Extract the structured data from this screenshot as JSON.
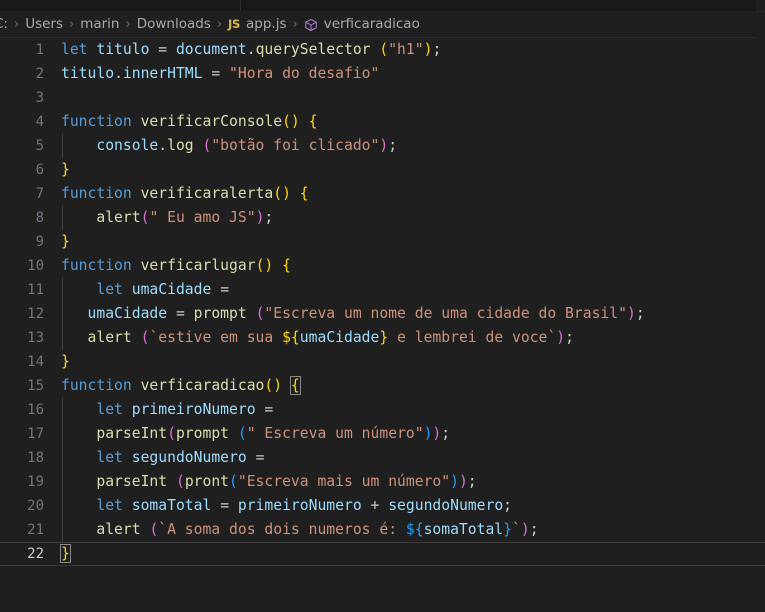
{
  "window": {
    "background": "#1f1f1f",
    "tabstrip_background": "#181818"
  },
  "breadcrumb": {
    "name": "file-path-breadcrumb",
    "segments": [
      {
        "label": "C:",
        "icon": null
      },
      {
        "label": "Users",
        "icon": null
      },
      {
        "label": "marin",
        "icon": null
      },
      {
        "label": "Downloads",
        "icon": null
      },
      {
        "label": "app.js",
        "icon": "js-file-icon"
      },
      {
        "label": "verficaradicao",
        "icon": "symbol-method-icon"
      }
    ],
    "separator": "›"
  },
  "editor": {
    "language": "javascript",
    "active_line": 22,
    "total_lines": 22,
    "colors": {
      "keyword": "#569CD6",
      "variable": "#9CDCFE",
      "function": "#DCDCAA",
      "string": "#CE9178",
      "bracket_1": "#FFD700",
      "bracket_2": "#DA70D6",
      "bracket_3": "#179FFF",
      "line_number": "#6E7681",
      "foreground": "#CCCCCC",
      "background": "#1F1F1F"
    },
    "lines": [
      {
        "n": "1",
        "text": "let titulo = document.querySelector (\"h1\");"
      },
      {
        "n": "2",
        "text": "titulo.innerHTML = \"Hora do desafio\""
      },
      {
        "n": "3",
        "text": ""
      },
      {
        "n": "4",
        "text": "function verificarConsole() {"
      },
      {
        "n": "5",
        "text": "    console.log (\"botão foi clicado\");"
      },
      {
        "n": "6",
        "text": "}"
      },
      {
        "n": "7",
        "text": "function verificaralerta() {"
      },
      {
        "n": "8",
        "text": "    alert(\" Eu amo JS\");"
      },
      {
        "n": "9",
        "text": "}"
      },
      {
        "n": "10",
        "text": "function verficarlugar() {"
      },
      {
        "n": "11",
        "text": "    let umaCidade ="
      },
      {
        "n": "12",
        "text": "    umaCidade = prompt (\"Escreva um nome de uma cidade do Brasil\");"
      },
      {
        "n": "13",
        "text": "    alert (`estive em sua ${umaCidade} e lembrei de voce`);"
      },
      {
        "n": "14",
        "text": "}"
      },
      {
        "n": "15",
        "text": "function verficaradicao() {"
      },
      {
        "n": "16",
        "text": "    let primeiroNumero ="
      },
      {
        "n": "17",
        "text": "    parseInt(prompt (\" Escreva um número\"));"
      },
      {
        "n": "18",
        "text": "    let segundoNumero ="
      },
      {
        "n": "19",
        "text": "    parseInt (pront(\"Escreva mais um número\"));"
      },
      {
        "n": "20",
        "text": "    let somaTotal = primeiroNumero + segundoNumero;"
      },
      {
        "n": "21",
        "text": "    alert (`A soma dos dois numeros é: ${somaTotal}`);"
      },
      {
        "n": "22",
        "text": "}"
      }
    ]
  }
}
